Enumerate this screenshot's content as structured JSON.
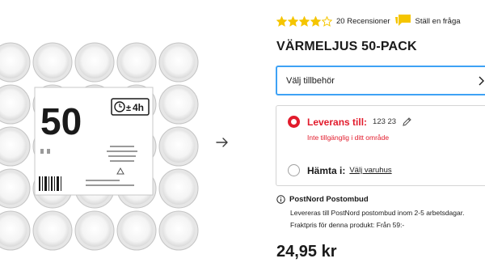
{
  "product": {
    "title": "VÄRMELJUS 50-PACK",
    "price": "24,95 kr",
    "image_alt": "Värmeljus 50-pack i förpackning"
  },
  "package": {
    "count": "50",
    "duration": "4h"
  },
  "rating": {
    "score": 4,
    "max": 5,
    "reviews_label": "20 Recensioner",
    "star_color": "#f5c500"
  },
  "ask": {
    "label": "Ställ en fråga",
    "icon": "chat-bubble-icon",
    "icon_color": "#f5c500"
  },
  "accessories": {
    "label": "Välj tillbehör",
    "border_color": "#3ea2f5"
  },
  "delivery": {
    "label": "Leverans till:",
    "postcode": "123 23",
    "status": "Inte tillgänglig i ditt område",
    "status_color": "#e21b2c",
    "selected": true
  },
  "pickup": {
    "label": "Hämta i:",
    "link": "Välj varuhus",
    "selected": false
  },
  "postnord": {
    "title": "PostNord Postombud",
    "line1": "Levereras till PostNord postombud inom 2-5 arbetsdagar.",
    "line2": "Fraktpris för denna produkt: Från 59:-"
  }
}
